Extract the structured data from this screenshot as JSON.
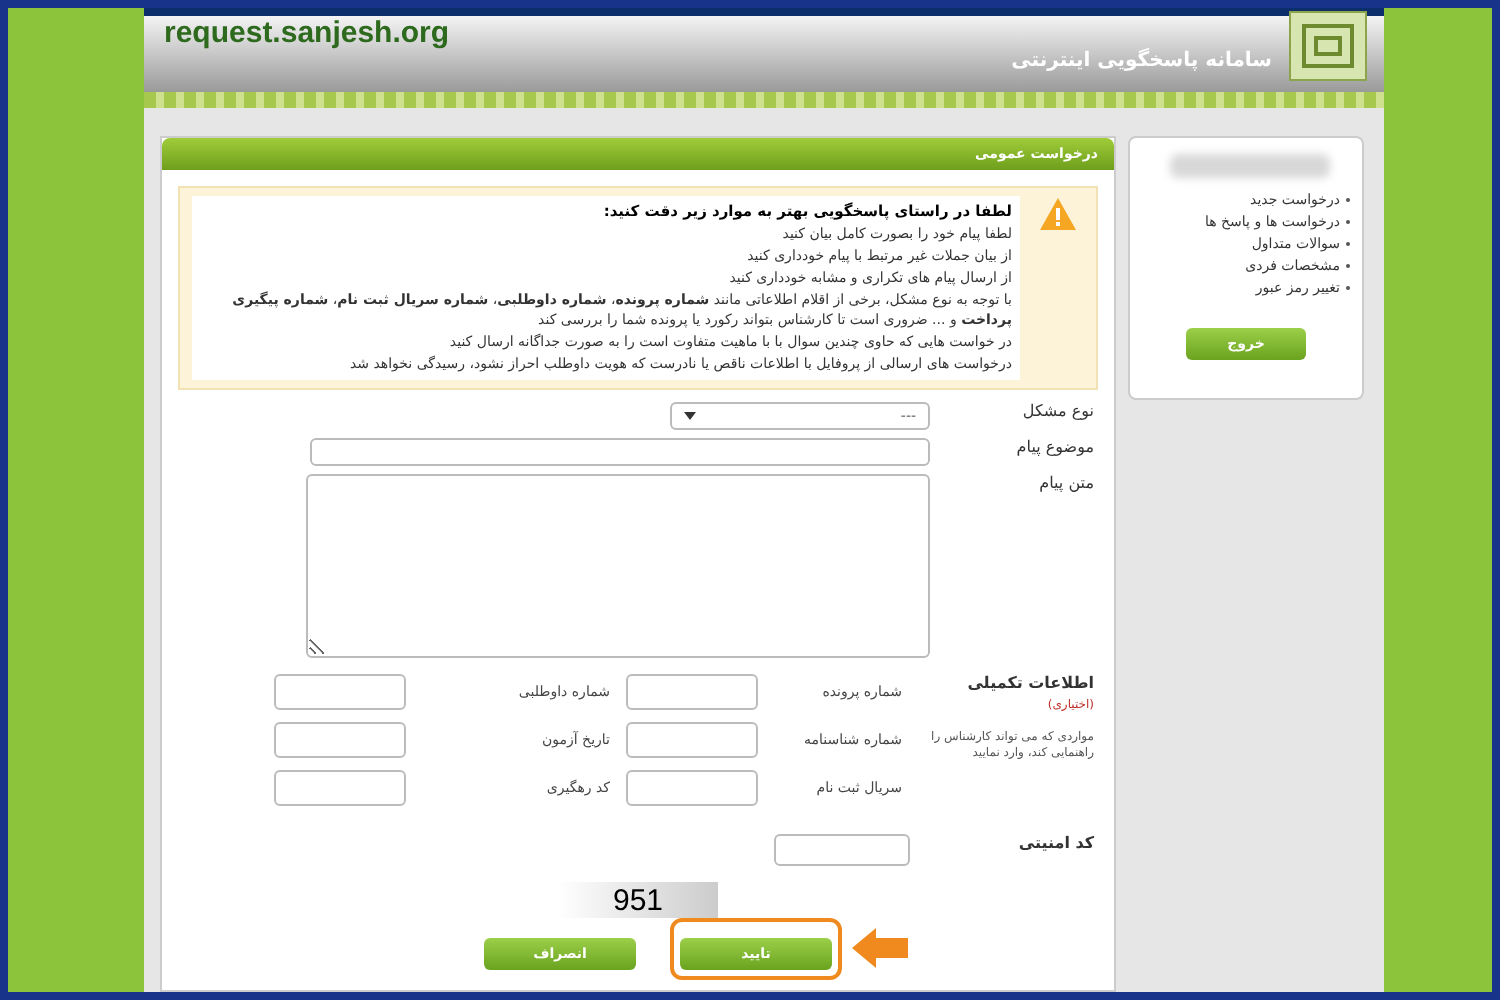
{
  "header": {
    "site": "request.sanjesh.org",
    "title": "سامانه پاسخگویی اینترنتی"
  },
  "sidebar": {
    "items": [
      {
        "label": "درخواست جدید"
      },
      {
        "label": "درخواست ها و پاسخ ها"
      },
      {
        "label": "سوالات متداول"
      },
      {
        "label": "مشخصات فردی"
      },
      {
        "label": "تغییر رمز عبور"
      }
    ],
    "logout": "خروج"
  },
  "panel": {
    "title": "درخواست عمومی"
  },
  "notice": {
    "heading": "لطفا در راستای پاسخگویی بهتر به موارد زیر دقت کنید:",
    "lines": [
      "لطفا پیام خود را بصورت کامل بیان کنید",
      "از بیان جملات غیر مرتبط با پیام خودداری کنید",
      "از ارسال پیام های تکراری و مشابه خودداری کنید",
      "با توجه به نوع مشکل، برخی از اقلام اطلاعاتی مانند **شماره پرونده**، **شماره داوطلبی**، **شماره سریال ثبت نام**، **شماره پیگیری پرداخت** و ... ضروری است تا کارشناس بتواند رکورد یا پرونده شما را بررسی کند",
      "در خواست هایی که حاوی چندین سوال با با ماهیت متفاوت است را به صورت جداگانه ارسال کنید",
      "درخواست های ارسالی از پروفایل با اطلاعات ناقص یا نادرست که هویت داوطلب احراز نشود، رسیدگی نخواهد شد"
    ]
  },
  "form": {
    "problem_type": {
      "label": "نوع مشکل",
      "value": "---"
    },
    "subject": {
      "label": "موضوع پیام"
    },
    "body": {
      "label": "متن پیام"
    }
  },
  "extra": {
    "title": "اطلاعات تکمیلی",
    "optional": "(اختیاری)",
    "hint": "مواردی که می تواند کارشناس را راهنمایی کند، وارد نمایید",
    "fields": [
      {
        "label": "شماره پرونده"
      },
      {
        "label": "شماره داوطلبی"
      },
      {
        "label": "شماره شناسنامه"
      },
      {
        "label": "تاریخ آزمون"
      },
      {
        "label": "سریال ثبت نام"
      },
      {
        "label": "کد رهگیری"
      }
    ]
  },
  "captcha": {
    "label": "کد امنیتی",
    "code": "951"
  },
  "buttons": [
    {
      "label": "تایید",
      "highlighted": true
    },
    {
      "label": "انصراف",
      "highlighted": false
    }
  ]
}
